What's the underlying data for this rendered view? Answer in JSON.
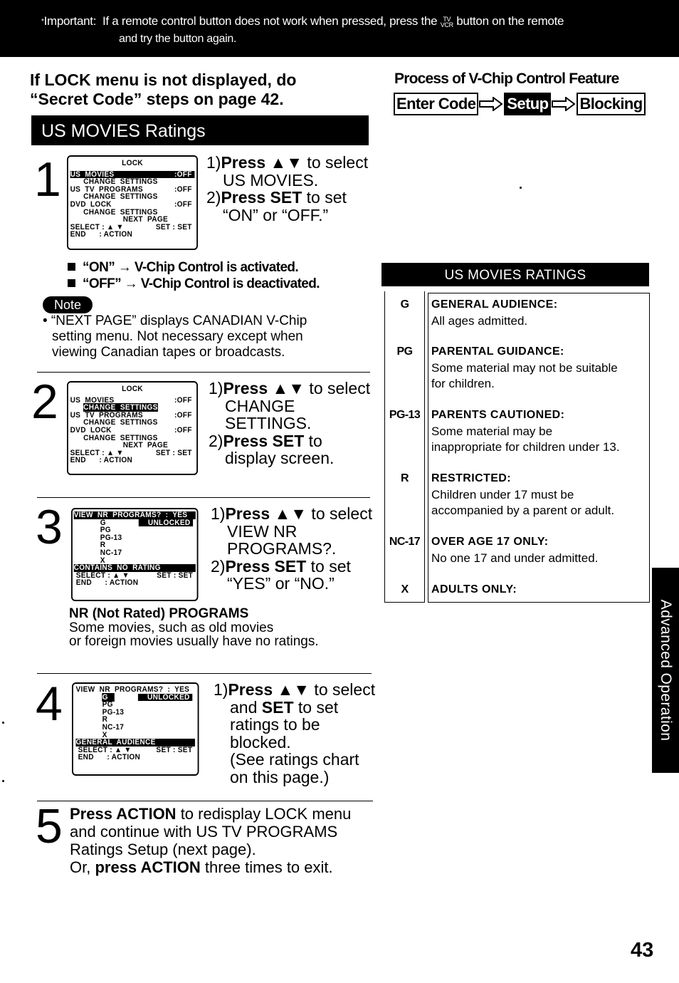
{
  "header": {
    "important_label": "Important:",
    "important_text_1": "If a remote control button does not work when pressed, press the",
    "tv_vcr_top": "TV",
    "tv_vcr_bottom": "VCR",
    "important_text_2": "button on the remote",
    "important_line2": "and try the button again."
  },
  "lock_warning": {
    "line1": "If LOCK menu is not displayed, do",
    "line2": "“Secret Code” steps on page 42."
  },
  "section_title": "US MOVIES Ratings",
  "process": {
    "title": "Process of V-Chip Control Feature",
    "steps": [
      "Enter Code",
      "Setup",
      "Blocking"
    ]
  },
  "steps": [
    {
      "number": "1",
      "osd": {
        "title": "LOCK",
        "rows": [
          {
            "left": "US  MOVIES",
            "right": ":OFF",
            "highlight": "full"
          },
          {
            "left": "      CHANGE  SETTINGS",
            "right": ""
          },
          {
            "left": "US  TV  PROGRAMS",
            "right": ":OFF"
          },
          {
            "left": "      CHANGE  SETTINGS",
            "right": ""
          },
          {
            "left": "DVD  LOCK",
            "right": ":OFF"
          },
          {
            "left": "      CHANGE  SETTINGS",
            "right": ""
          },
          {
            "left": "                        NEXT  PAGE",
            "right": ""
          },
          {
            "left": "SELECT : ▲ ▼",
            "right": "SET : SET"
          },
          {
            "left": "END      : ACTION",
            "right": ""
          }
        ]
      },
      "instructions": {
        "l1_num": "1)",
        "l1_bold": "Press ▲▼",
        "l1_rest": " to select",
        "l2": "US MOVIES.",
        "l3_num": "2)",
        "l3_bold": "Press SET",
        "l3_rest": " to set",
        "l4": "“ON” or “OFF.”"
      },
      "bullets": [
        "“ON” → V-Chip Control is activated.",
        "“OFF” → V-Chip Control is deactivated."
      ],
      "note_label": "Note",
      "note_l1": "• “NEXT PAGE” displays CANADIAN V-Chip",
      "note_l2": "setting menu. Not necessary except when",
      "note_l3": "viewing Canadian tapes or broadcasts."
    },
    {
      "number": "2",
      "osd": {
        "title": "LOCK",
        "rows": [
          {
            "left": "US  MOVIES",
            "right": ":OFF"
          },
          {
            "left": "      CHANGE  SETTINGS",
            "right": "",
            "highlight": "text"
          },
          {
            "left": "US  TV  PROGRAMS",
            "right": ":OFF"
          },
          {
            "left": "      CHANGE  SETTINGS",
            "right": ""
          },
          {
            "left": "DVD  LOCK",
            "right": ":OFF"
          },
          {
            "left": "      CHANGE  SETTINGS",
            "right": ""
          },
          {
            "left": "                        NEXT  PAGE",
            "right": ""
          },
          {
            "left": "SELECT : ▲ ▼",
            "right": "SET : SET"
          },
          {
            "left": "END      : ACTION",
            "right": ""
          }
        ]
      },
      "instructions": {
        "l1_num": "1)",
        "l1_bold": "Press ▲▼",
        "l1_rest": " to select",
        "l2": "CHANGE",
        "l3": "SETTINGS.",
        "l4_num": "2)",
        "l4_bold": "Press SET",
        "l4_rest": " to",
        "l5": "display screen."
      }
    },
    {
      "number": "3",
      "osd": {
        "rows": [
          {
            "left": "VIEW  NR  PROGRAMS?  :  YES",
            "right": "",
            "highlight": "full"
          },
          {
            "left": "            G",
            "right": "UNLOCKED",
            "right_hl": true
          },
          {
            "left": "            PG",
            "right": ""
          },
          {
            "left": "            PG-13",
            "right": ""
          },
          {
            "left": "            R",
            "right": ""
          },
          {
            "left": "            NC-17",
            "right": ""
          },
          {
            "left": "            X",
            "right": ""
          },
          {
            "left": "CONTAINS  NO  RATING",
            "right": "",
            "highlight": "full"
          },
          {
            "left": " SELECT : ▲ ▼",
            "right": "SET : SET"
          },
          {
            "left": " END      : ACTION",
            "right": ""
          }
        ]
      },
      "instructions": {
        "l1_num": "1)",
        "l1_bold": "Press ▲▼",
        "l1_rest": " to select",
        "l2": "VIEW NR",
        "l3": "PROGRAMS?.",
        "l4_num": "2)",
        "l4_bold": "Press SET",
        "l4_rest": " to set",
        "l5": "“YES” or “NO.”"
      },
      "nr_title": "NR (Not Rated) PROGRAMS",
      "nr_l1": "Some movies, such as old movies",
      "nr_l2": "or foreign movies usually have no ratings."
    },
    {
      "number": "4",
      "osd": {
        "rows": [
          {
            "left": "VIEW  NR  PROGRAMS?  :  YES",
            "right": ""
          },
          {
            "left": "            G",
            "right": "UNLOCKED",
            "right_hl": true,
            "left_hl": true
          },
          {
            "left": "            PG",
            "right": ""
          },
          {
            "left": "            PG-13",
            "right": ""
          },
          {
            "left": "            R",
            "right": ""
          },
          {
            "left": "            NC-17",
            "right": ""
          },
          {
            "left": "            X",
            "right": ""
          },
          {
            "left": "GENERAL  AUDIENCE",
            "right": "",
            "highlight": "full"
          },
          {
            "left": " SELECT : ▲ ▼",
            "right": "SET : SET"
          },
          {
            "left": " END      : ACTION",
            "right": ""
          }
        ]
      },
      "instructions": {
        "l1_num": "1)",
        "l1_bold": "Press ▲▼",
        "l1_rest": " to select",
        "l2_pre": "and ",
        "l2_bold": "SET",
        "l2_rest": " to set",
        "l3": "ratings to be",
        "l4": "blocked.",
        "l5": "(See ratings chart",
        "l6": "on this page.)"
      }
    },
    {
      "number": "5",
      "l1_bold": "Press ACTION",
      "l1_rest": " to redisplay LOCK menu",
      "l2": "and continue with US TV PROGRAMS",
      "l3": "Ratings Setup (next page).",
      "l4_pre": "Or, ",
      "l4_bold": "press ACTION",
      "l4_rest": " three times to exit."
    }
  ],
  "ratings": {
    "title": "US MOVIES RATINGS",
    "rows": [
      {
        "code": "G",
        "title": "GENERAL AUDIENCE:",
        "desc": [
          "All ages admitted."
        ]
      },
      {
        "code": "PG",
        "title": "PARENTAL GUIDANCE:",
        "desc": [
          "Some material may not be suitable",
          "for children."
        ]
      },
      {
        "code": "PG-13",
        "title": "PARENTS CAUTIONED:",
        "desc": [
          "Some material may be",
          "inappropriate for children under 13."
        ]
      },
      {
        "code": "R",
        "title": "RESTRICTED:",
        "desc": [
          "Children under 17 must be",
          "accompanied by a parent or adult."
        ]
      },
      {
        "code": "NC-17",
        "title": "OVER AGE 17 ONLY:",
        "desc": [
          "No one 17 and under admitted."
        ]
      },
      {
        "code": "X",
        "title": "ADULTS ONLY:",
        "desc": []
      }
    ]
  },
  "side_tab": "Advanced Operation",
  "page_number": "43"
}
